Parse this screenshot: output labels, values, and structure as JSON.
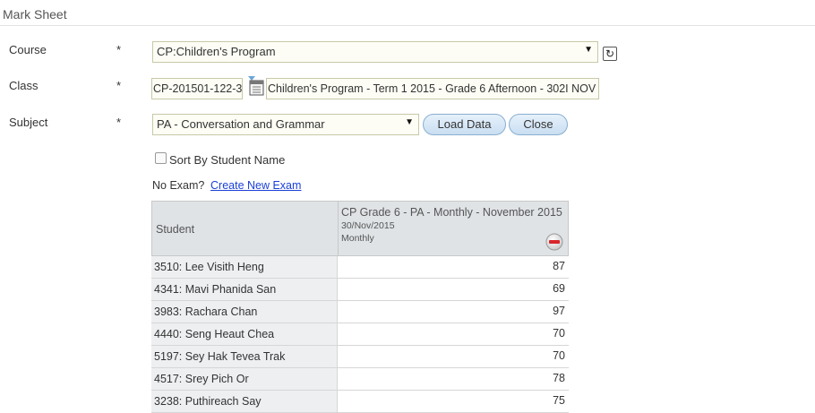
{
  "page": {
    "title": "Mark Sheet"
  },
  "form": {
    "course": {
      "label": "Course",
      "required": "*",
      "value": "CP:Children's Program"
    },
    "class": {
      "label": "Class",
      "required": "*",
      "code": "CP-201501-122-3",
      "name": "Children's Program - Term 1 2015 - Grade 6 Afternoon - 302I NOV"
    },
    "subject": {
      "label": "Subject",
      "required": "*",
      "value": "PA - Conversation and Grammar"
    },
    "buttons": {
      "load": "Load Data",
      "close": "Close"
    },
    "sort": {
      "label": "Sort By Student Name",
      "checked": false
    },
    "no_exam": {
      "text": "No Exam?",
      "link": "Create New Exam"
    }
  },
  "grid": {
    "student_header": "Student",
    "exam": {
      "title": "CP Grade 6 - PA - Monthly - November 2015",
      "date": "30/Nov/2015",
      "type": "Monthly"
    },
    "rows": [
      {
        "student": "3510: Lee Visith Heng",
        "mark": "87"
      },
      {
        "student": "4341: Mavi Phanida San",
        "mark": "69"
      },
      {
        "student": "3983: Rachara Chan",
        "mark": "97"
      },
      {
        "student": "4440: Seng Heaut Chea",
        "mark": "70"
      },
      {
        "student": "5197: Sey Hak Tevea Trak",
        "mark": "70"
      },
      {
        "student": "4517: Srey Pich Or",
        "mark": "78"
      },
      {
        "student": "3238: Puthireach Say",
        "mark": "75"
      }
    ]
  },
  "icons": {
    "refresh": "refresh-icon",
    "lookup": "lookup-icon",
    "remove": "remove-icon",
    "dropdown": "chevron-down-icon"
  },
  "colors": {
    "input_bg": "#fdfdf5",
    "input_border": "#c8c8a8",
    "button_bg": "#c9def2",
    "link": "#1a3fd8",
    "remove_red": "#d9262b"
  }
}
